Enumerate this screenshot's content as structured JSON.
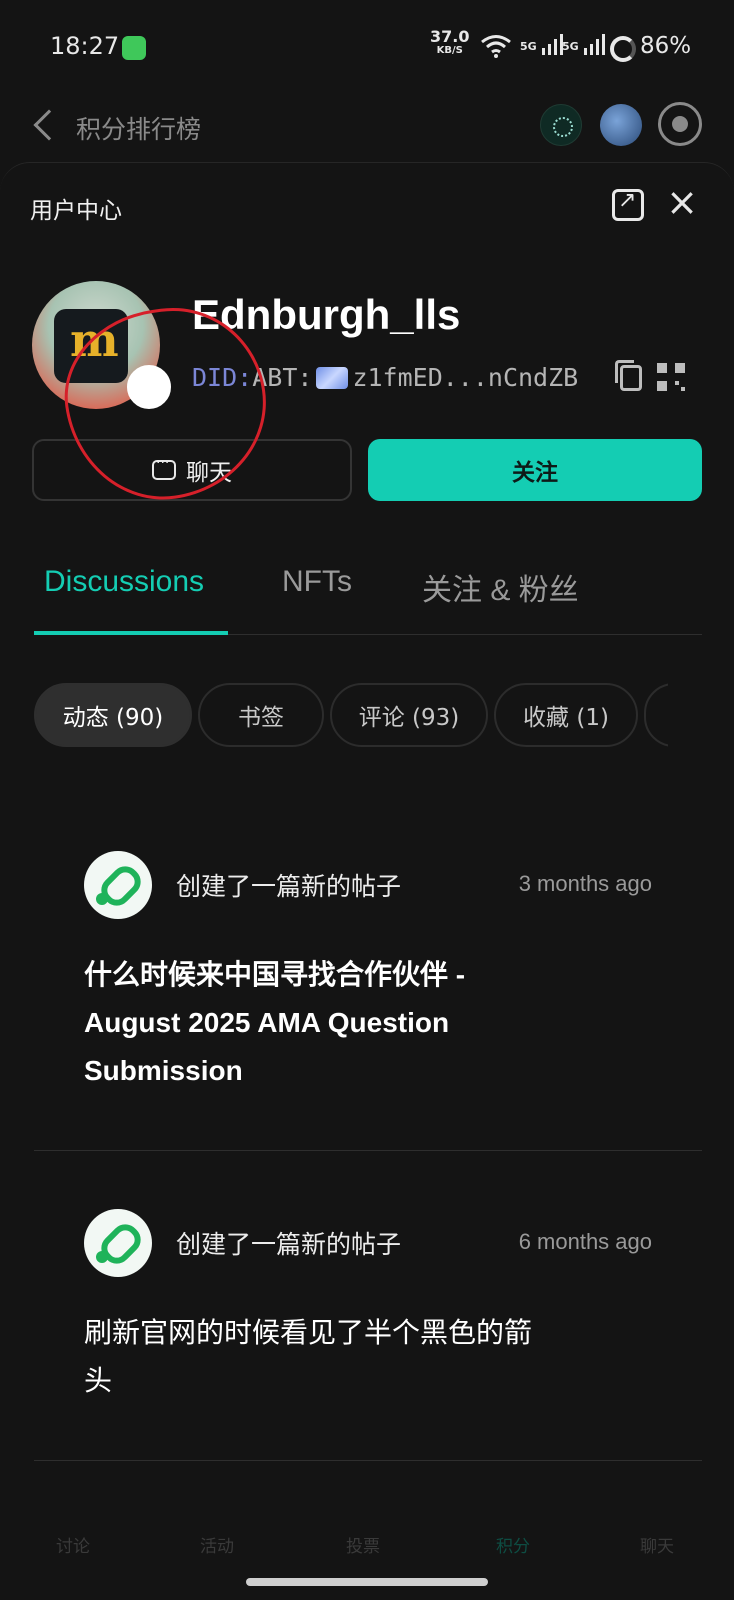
{
  "status_bar": {
    "time": "18:27",
    "net_speed": "37.0",
    "net_speed_unit": "KB/S",
    "signal1": "5G",
    "signal2": "5G",
    "battery": "86%"
  },
  "app_bar": {
    "title": "积分排行榜"
  },
  "sheet": {
    "title": "用户中心"
  },
  "profile": {
    "username": "Ednburgh_lls",
    "did_prefix": "DID:",
    "did_type": "ABT:",
    "did_short": "z1fmED...nCndZB",
    "badge_emoji": "😇",
    "avatar_letter": "m"
  },
  "buttons": {
    "chat": "聊天",
    "follow": "关注"
  },
  "tabs": [
    {
      "label": "Discussions",
      "active": true
    },
    {
      "label": "NFTs",
      "active": false
    },
    {
      "label": "关注 & 粉丝",
      "active": false
    }
  ],
  "chips": [
    {
      "label": "动态 (90)",
      "active": true
    },
    {
      "label": "书签",
      "active": false
    },
    {
      "label": "评论 (93)",
      "active": false
    },
    {
      "label": "收藏 (1)",
      "active": false
    }
  ],
  "posts": [
    {
      "action": "创建了一篇新的帖子",
      "time": "3 months ago",
      "title": "什么时候来中国寻找合作伙伴 - August 2025 AMA Question Submission"
    },
    {
      "action": "创建了一篇新的帖子",
      "time": "6 months ago",
      "title": "刷新官网的时候看见了半个黑色的箭头"
    }
  ],
  "bottom_nav": [
    "讨论",
    "活动",
    "投票",
    "积分",
    "聊天"
  ],
  "colors": {
    "accent": "#14cdb3",
    "background": "#141414",
    "annotation": "#d6202a"
  }
}
